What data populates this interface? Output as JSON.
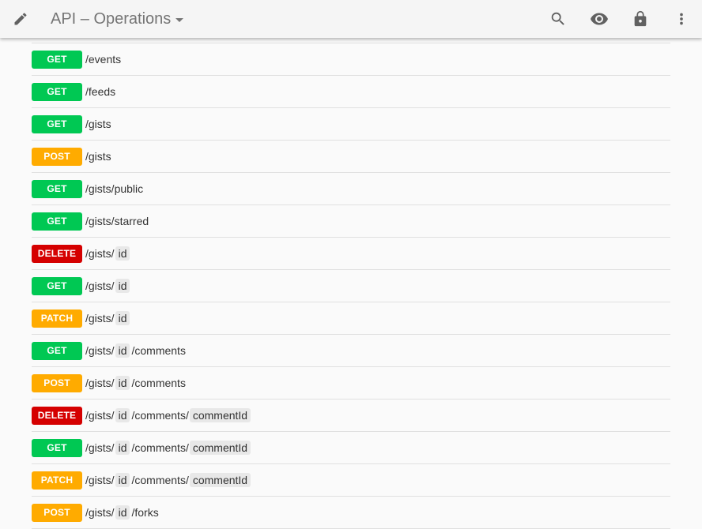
{
  "toolbar": {
    "title": "API – Operations",
    "edit_icon": "pencil-icon",
    "actions": [
      "search-icon",
      "eye-icon",
      "lock-icon",
      "more-vert-icon"
    ]
  },
  "colors": {
    "GET": "#00c853",
    "POST": "#ffab00",
    "DELETE": "#d50000",
    "PATCH": "#ffab00"
  },
  "operations": [
    {
      "method": "GET",
      "segments": [
        {
          "t": "/events",
          "p": false
        }
      ]
    },
    {
      "method": "GET",
      "segments": [
        {
          "t": "/feeds",
          "p": false
        }
      ]
    },
    {
      "method": "GET",
      "segments": [
        {
          "t": "/gists",
          "p": false
        }
      ]
    },
    {
      "method": "POST",
      "segments": [
        {
          "t": "/gists",
          "p": false
        }
      ]
    },
    {
      "method": "GET",
      "segments": [
        {
          "t": "/gists/public",
          "p": false
        }
      ]
    },
    {
      "method": "GET",
      "segments": [
        {
          "t": "/gists/starred",
          "p": false
        }
      ]
    },
    {
      "method": "DELETE",
      "segments": [
        {
          "t": "/gists/",
          "p": false
        },
        {
          "t": "id",
          "p": true
        }
      ]
    },
    {
      "method": "GET",
      "segments": [
        {
          "t": "/gists/",
          "p": false
        },
        {
          "t": "id",
          "p": true
        }
      ]
    },
    {
      "method": "PATCH",
      "segments": [
        {
          "t": "/gists/",
          "p": false
        },
        {
          "t": "id",
          "p": true
        }
      ]
    },
    {
      "method": "GET",
      "segments": [
        {
          "t": "/gists/",
          "p": false
        },
        {
          "t": "id",
          "p": true
        },
        {
          "t": "/comments",
          "p": false
        }
      ]
    },
    {
      "method": "POST",
      "segments": [
        {
          "t": "/gists/",
          "p": false
        },
        {
          "t": "id",
          "p": true
        },
        {
          "t": "/comments",
          "p": false
        }
      ]
    },
    {
      "method": "DELETE",
      "segments": [
        {
          "t": "/gists/",
          "p": false
        },
        {
          "t": "id",
          "p": true
        },
        {
          "t": "/comments/",
          "p": false
        },
        {
          "t": "commentId",
          "p": true
        }
      ]
    },
    {
      "method": "GET",
      "segments": [
        {
          "t": "/gists/",
          "p": false
        },
        {
          "t": "id",
          "p": true
        },
        {
          "t": "/comments/",
          "p": false
        },
        {
          "t": "commentId",
          "p": true
        }
      ]
    },
    {
      "method": "PATCH",
      "segments": [
        {
          "t": "/gists/",
          "p": false
        },
        {
          "t": "id",
          "p": true
        },
        {
          "t": "/comments/",
          "p": false
        },
        {
          "t": "commentId",
          "p": true
        }
      ]
    },
    {
      "method": "POST",
      "segments": [
        {
          "t": "/gists/",
          "p": false
        },
        {
          "t": "id",
          "p": true
        },
        {
          "t": "/forks",
          "p": false
        }
      ]
    }
  ]
}
